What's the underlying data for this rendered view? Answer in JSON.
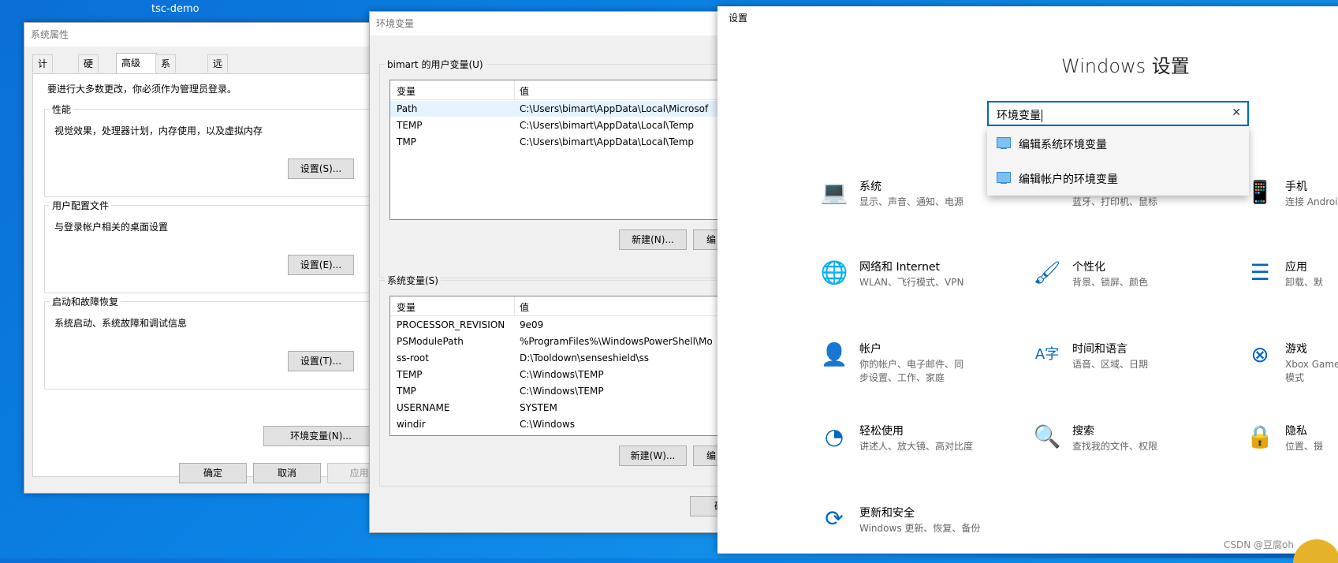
{
  "desktop": {
    "title": "tsc-demo",
    "watermark": "CSDN @豆腐oh"
  },
  "sys_props": {
    "title": "系统属性",
    "tabs": [
      "计算机名",
      "硬件",
      "高级",
      "系统保护",
      "远程"
    ],
    "admin_note": "要进行大多数更改，你必须作为管理员登录。",
    "groups": [
      {
        "label": "性能",
        "desc": "视觉效果，处理器计划，内存使用，以及虚拟内存",
        "button": "设置(S)..."
      },
      {
        "label": "用户配置文件",
        "desc": "与登录帐户相关的桌面设置",
        "button": "设置(E)..."
      },
      {
        "label": "启动和故障恢复",
        "desc": "系统启动、系统故障和调试信息",
        "button": "设置(T)..."
      }
    ],
    "env_button": "环境变量(N)...",
    "ok": "确定",
    "cancel": "取消",
    "apply": "应用("
  },
  "env_vars": {
    "title": "环境变量",
    "user_section": "bimart 的用户变量(U)",
    "col_var": "变量",
    "col_val": "值",
    "user_rows": [
      {
        "var": "Path",
        "val": "C:\\Users\\bimart\\AppData\\Local\\Microsof"
      },
      {
        "var": "TEMP",
        "val": "C:\\Users\\bimart\\AppData\\Local\\Temp"
      },
      {
        "var": "TMP",
        "val": "C:\\Users\\bimart\\AppData\\Local\\Temp"
      }
    ],
    "user_new": "新建(N)...",
    "user_edit": "编",
    "sys_section": "系统变量(S)",
    "sys_rows": [
      {
        "var": "PROCESSOR_REVISION",
        "val": "9e09"
      },
      {
        "var": "PSModulePath",
        "val": "%ProgramFiles%\\WindowsPowerShell\\Mo"
      },
      {
        "var": "ss-root",
        "val": "D:\\Tooldown\\senseshield\\ss"
      },
      {
        "var": "TEMP",
        "val": "C:\\Windows\\TEMP"
      },
      {
        "var": "TMP",
        "val": "C:\\Windows\\TEMP"
      },
      {
        "var": "USERNAME",
        "val": "SYSTEM"
      },
      {
        "var": "windir",
        "val": "C:\\Windows"
      }
    ],
    "sys_new": "新建(W)...",
    "sys_edit": "编",
    "ok_partial": "确"
  },
  "settings": {
    "title": "设置",
    "heading": "Windows 设置",
    "search_value": "环境变量",
    "results": [
      "编辑系统环境变量",
      "编辑帐户的环境变量"
    ],
    "categories": [
      {
        "name": "系统",
        "sub": "显示、声音、通知、电源",
        "icon": "laptop-icon",
        "glyph": "💻"
      },
      {
        "name": "",
        "sub": "蓝牙、打印机、鼠标",
        "icon": "devices-icon",
        "glyph": ""
      },
      {
        "name": "手机",
        "sub": "连接 Androi",
        "icon": "phone-icon",
        "glyph": "📱"
      },
      {
        "name": "网络和 Internet",
        "sub": "WLAN、飞行模式、VPN",
        "icon": "globe-icon",
        "glyph": "🌐"
      },
      {
        "name": "个性化",
        "sub": "背景、锁屏、颜色",
        "icon": "personalize-icon",
        "glyph": "🖌"
      },
      {
        "name": "应用",
        "sub": "卸载、默",
        "icon": "apps-icon",
        "glyph": "☰"
      },
      {
        "name": "帐户",
        "sub": "你的帐户、电子邮件、同步设置、工作、家庭",
        "icon": "person-icon",
        "glyph": "👤"
      },
      {
        "name": "时间和语言",
        "sub": "语音、区域、日期",
        "icon": "time-language-icon",
        "glyph": "A字"
      },
      {
        "name": "游戏",
        "sub": "Xbox Game 模式",
        "icon": "xbox-icon",
        "glyph": "⊗"
      },
      {
        "name": "轻松使用",
        "sub": "讲述人、放大镜、高对比度",
        "icon": "ease-of-access-icon",
        "glyph": "◔"
      },
      {
        "name": "搜索",
        "sub": "查找我的文件、权限",
        "icon": "search-icon",
        "glyph": "🔍"
      },
      {
        "name": "隐私",
        "sub": "位置、摄",
        "icon": "lock-icon",
        "glyph": "🔒"
      },
      {
        "name": "更新和安全",
        "sub": "Windows 更新、恢复、备份",
        "icon": "update-icon",
        "glyph": "⟳"
      }
    ],
    "accent": "#0067c0"
  }
}
